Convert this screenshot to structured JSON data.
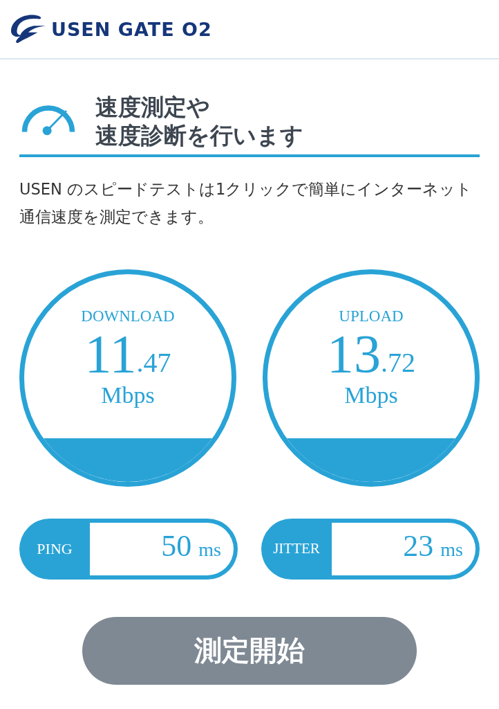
{
  "header": {
    "logo_text": "USEN GATE O2"
  },
  "heading": {
    "lines": [
      "速度測定や",
      "速度診断を行います"
    ]
  },
  "description": "USEN のスピードテストは1クリックで簡単にインターネット通信速度を測定できます。",
  "gauges": [
    {
      "label": "DOWNLOAD",
      "integer": "11",
      "decimal": ".47",
      "unit": "Mbps"
    },
    {
      "label": "UPLOAD",
      "integer": "13",
      "decimal": ".72",
      "unit": "Mbps"
    }
  ],
  "stats": [
    {
      "label": "PING",
      "value": "50",
      "unit": "ms"
    },
    {
      "label": "JITTER",
      "value": "23",
      "unit": "ms"
    }
  ],
  "start_button": {
    "label": "測定開始",
    "disabled": true
  }
}
